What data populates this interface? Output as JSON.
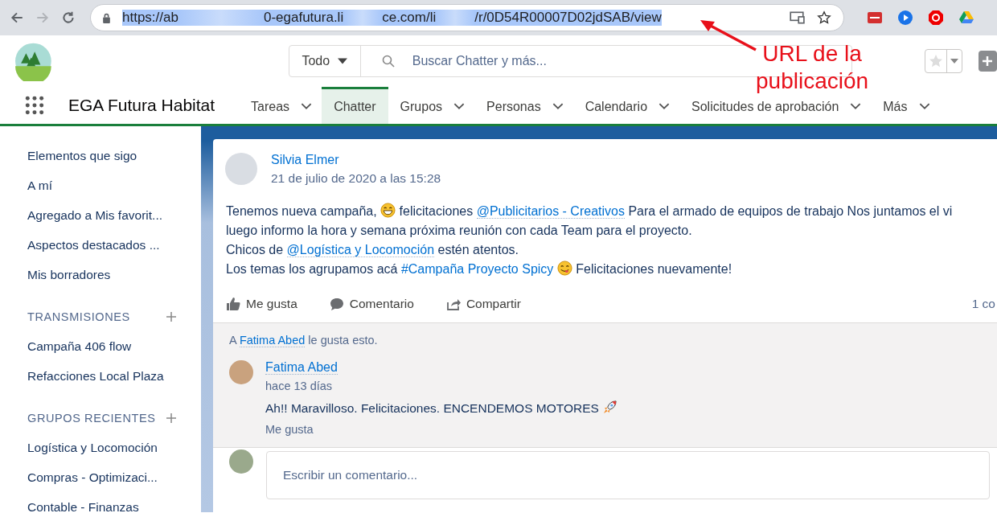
{
  "browser": {
    "url_parts": [
      "https://ab",
      "0-egafutura.li",
      "ce.com/li",
      "/r/0D54R00007D02jdSAB/view"
    ]
  },
  "annotation": {
    "lines": [
      "URL de la",
      "publicación"
    ]
  },
  "header": {
    "search_scope": "Todo",
    "search_placeholder": "Buscar Chatter y más...",
    "app_name": "EGA Futura Habitat"
  },
  "nav_tabs": [
    {
      "label": "Tareas",
      "has_menu": true,
      "selected": false
    },
    {
      "label": "Chatter",
      "has_menu": false,
      "selected": true
    },
    {
      "label": "Grupos",
      "has_menu": true,
      "selected": false
    },
    {
      "label": "Personas",
      "has_menu": true,
      "selected": false
    },
    {
      "label": "Calendario",
      "has_menu": true,
      "selected": false
    },
    {
      "label": "Solicitudes de aprobación",
      "has_menu": true,
      "selected": false
    },
    {
      "label": "Más",
      "has_menu": true,
      "selected": false
    }
  ],
  "sidebar": {
    "items": [
      "Elementos que sigo",
      "A mí",
      "Agregado a Mis favorit...",
      "Aspectos destacados ...",
      "Mis borradores"
    ],
    "sections": [
      {
        "title": "TRANSMISIONES",
        "items": [
          "Campaña 406 flow",
          "Refacciones Local Plaza"
        ]
      },
      {
        "title": "GRUPOS RECIENTES",
        "items": [
          "Logística y Locomoción",
          "Compras - Optimizaci...",
          "Contable - Finanzas"
        ]
      }
    ]
  },
  "post": {
    "author": "Silvia Elmer",
    "timestamp": "21 de julio de 2020 a las 15:28",
    "lines": [
      [
        {
          "kind": "text",
          "text": "Tenemos nueva campaña,"
        },
        {
          "kind": "grin_emoji"
        },
        {
          "kind": "text",
          "text": "felicitaciones"
        },
        {
          "kind": "mention",
          "text": "@Publicitarios - Creativos"
        },
        {
          "kind": "text",
          "text": "Para el armado de equipos de trabajo Nos juntamos el vi"
        }
      ],
      [
        {
          "kind": "text",
          "text": "luego informo la hora y semana próxima reunión con cada Team para el proyecto."
        }
      ],
      [
        {
          "kind": "text",
          "text": "Chicos de"
        },
        {
          "kind": "mention",
          "text": "@Logística y Locomoción"
        },
        {
          "kind": "text",
          "text": "estén atentos."
        }
      ],
      [
        {
          "kind": "text",
          "text": "Los temas los agrupamos acá"
        },
        {
          "kind": "topic",
          "text": "#Campaña Proyecto Spicy"
        },
        {
          "kind": "tongue_emoji"
        },
        {
          "kind": "text",
          "text": "Felicitaciones nuevamente!"
        }
      ]
    ],
    "actions": [
      {
        "label": "Me gusta",
        "kind": "like"
      },
      {
        "label": "Comentario",
        "kind": "comment"
      },
      {
        "label": "Compartir",
        "kind": "share"
      }
    ],
    "comment_count": "1 co",
    "likes": {
      "prefix": "A",
      "name": "Fatima Abed",
      "suffix": "le gusta esto."
    },
    "comments": [
      {
        "author": "Fatima Abed",
        "time": "hace 13 días",
        "text": "Ah!! Maravilloso. Felicitaciones. ENCENDEMOS MOTORES",
        "kind": "with_rocket_emoji",
        "like_label": "Me gusta"
      }
    ],
    "comment_placeholder": "Escribir un comentario..."
  }
}
